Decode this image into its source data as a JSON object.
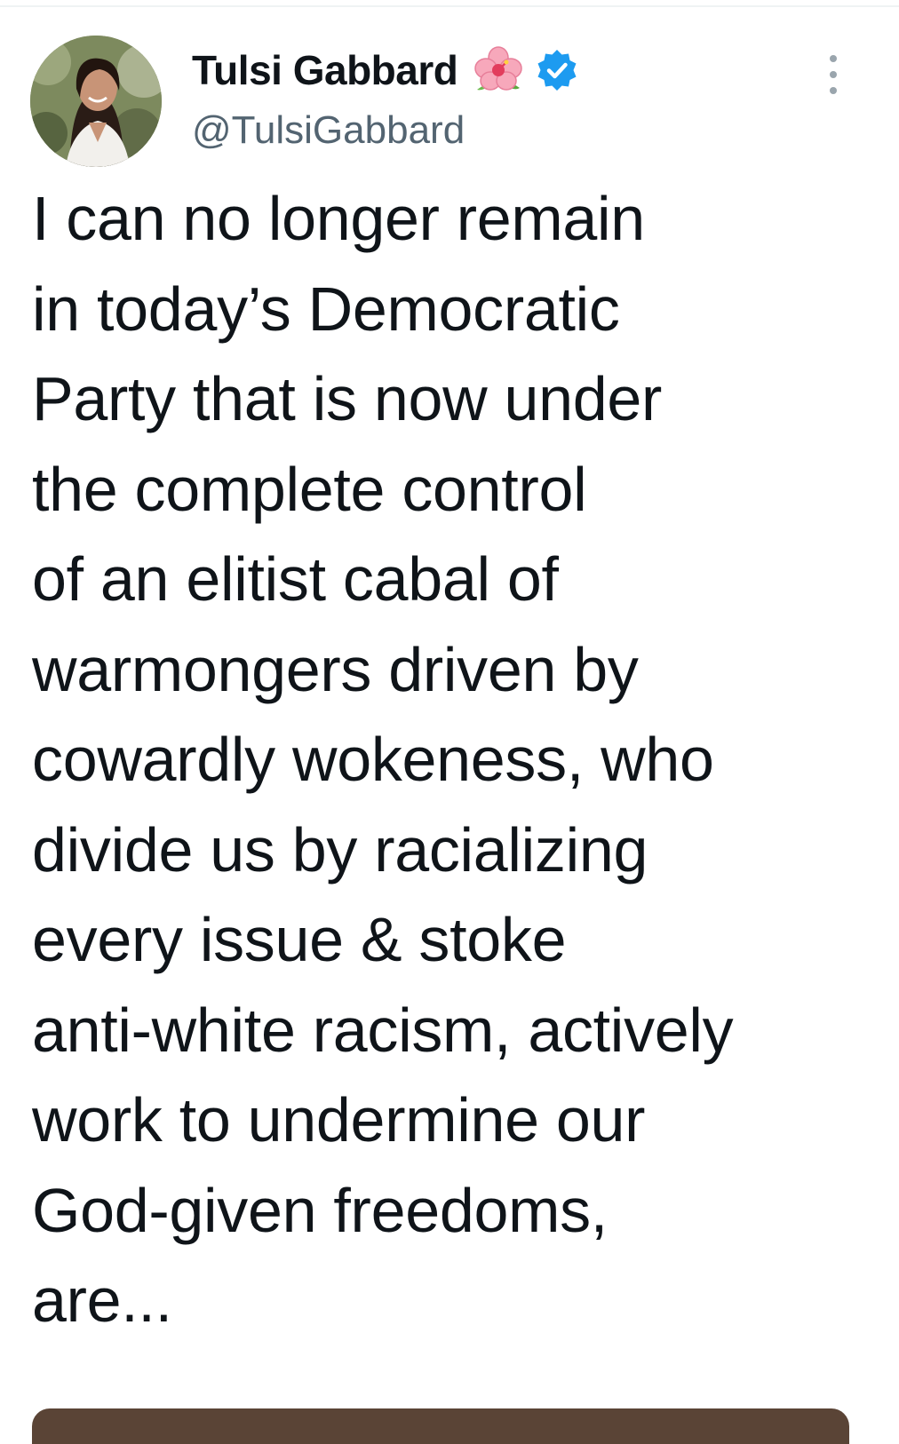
{
  "tweet": {
    "author": {
      "display_name": "Tulsi Gabbard",
      "handle": "@TulsiGabbard",
      "flair_icon": "hibiscus-flower-icon",
      "verified_icon": "verified-badge-icon",
      "verified_color": "#1d9bf0"
    },
    "more_icon": "more-options-icon",
    "text_lines": [
      "I can no longer remain",
      "in today’s Democratic",
      "Party that is now under",
      "the complete control",
      "of an elitist cabal of",
      "warmongers driven by",
      "cowardly wokeness, who",
      "divide us by racializing",
      "every issue & stoke",
      "anti-white racism, actively",
      "work to undermine our",
      "God-given freedoms,",
      "are..."
    ]
  },
  "colors": {
    "text_primary": "#0f1419",
    "text_secondary": "#536471",
    "background": "#ffffff"
  }
}
